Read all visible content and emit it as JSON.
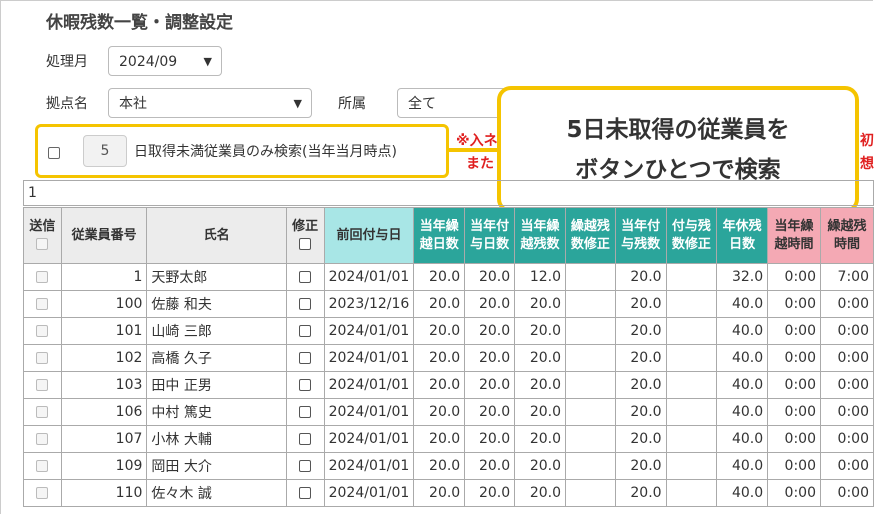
{
  "page": {
    "title": "休暇残数一覧・調整設定"
  },
  "filters": {
    "month_label": "処理月",
    "month_value": "2024/09",
    "base_label": "拠点名",
    "base_value": "本社",
    "dept_label": "所属",
    "dept_value": "全て"
  },
  "search5": {
    "days": "5",
    "label": "日取得未満従業員のみ検索(当年当月時点)"
  },
  "notes": {
    "line1_visible": "※入ネ",
    "line2_visible": "また",
    "right1": "初",
    "right2": "想"
  },
  "callout": {
    "line1": "5日未取得の従業員を",
    "line2": "ボタンひとつで検索"
  },
  "pagination": {
    "value": "1"
  },
  "table": {
    "headers": {
      "send": "送信",
      "emp_no": "従業員番号",
      "name": "氏名",
      "fix": "修正",
      "prev_date": "前回付与日",
      "h1a": "当年繰",
      "h1b": "越日数",
      "h2a": "当年付",
      "h2b": "与日数",
      "h3a": "当年繰",
      "h3b": "越残数",
      "h4a": "繰越残",
      "h4b": "数修正",
      "h5a": "当年付",
      "h5b": "与残数",
      "h6a": "付与残",
      "h6b": "数修正",
      "h7a": "年休残",
      "h7b": "日数",
      "h8a": "当年繰",
      "h8b": "越時間",
      "h9a": "繰越残",
      "h9b": "時間"
    },
    "rows": [
      {
        "no": "1",
        "name": "天野太郎",
        "date": "2024/01/01",
        "a": "20.0",
        "b": "20.0",
        "c": "12.0",
        "d": "",
        "e": "20.0",
        "f": "",
        "g": "32.0",
        "h": "0:00",
        "i": "7:00"
      },
      {
        "no": "100",
        "name": "佐藤 和夫",
        "date": "2023/12/16",
        "a": "20.0",
        "b": "20.0",
        "c": "20.0",
        "d": "",
        "e": "20.0",
        "f": "",
        "g": "40.0",
        "h": "0:00",
        "i": "0:00"
      },
      {
        "no": "101",
        "name": "山崎 三郎",
        "date": "2024/01/01",
        "a": "20.0",
        "b": "20.0",
        "c": "20.0",
        "d": "",
        "e": "20.0",
        "f": "",
        "g": "40.0",
        "h": "0:00",
        "i": "0:00"
      },
      {
        "no": "102",
        "name": "高橋 久子",
        "date": "2024/01/01",
        "a": "20.0",
        "b": "20.0",
        "c": "20.0",
        "d": "",
        "e": "20.0",
        "f": "",
        "g": "40.0",
        "h": "0:00",
        "i": "0:00"
      },
      {
        "no": "103",
        "name": "田中 正男",
        "date": "2024/01/01",
        "a": "20.0",
        "b": "20.0",
        "c": "20.0",
        "d": "",
        "e": "20.0",
        "f": "",
        "g": "40.0",
        "h": "0:00",
        "i": "0:00"
      },
      {
        "no": "106",
        "name": "中村 篤史",
        "date": "2024/01/01",
        "a": "20.0",
        "b": "20.0",
        "c": "20.0",
        "d": "",
        "e": "20.0",
        "f": "",
        "g": "40.0",
        "h": "0:00",
        "i": "0:00"
      },
      {
        "no": "107",
        "name": "小林 大輔",
        "date": "2024/01/01",
        "a": "20.0",
        "b": "20.0",
        "c": "20.0",
        "d": "",
        "e": "20.0",
        "f": "",
        "g": "40.0",
        "h": "0:00",
        "i": "0:00"
      },
      {
        "no": "109",
        "name": "岡田 大介",
        "date": "2024/01/01",
        "a": "20.0",
        "b": "20.0",
        "c": "20.0",
        "d": "",
        "e": "20.0",
        "f": "",
        "g": "40.0",
        "h": "0:00",
        "i": "0:00"
      },
      {
        "no": "110",
        "name": "佐々木 誠",
        "date": "2024/01/01",
        "a": "20.0",
        "b": "20.0",
        "c": "20.0",
        "d": "",
        "e": "20.0",
        "f": "",
        "g": "40.0",
        "h": "0:00",
        "i": "0:00"
      }
    ]
  }
}
